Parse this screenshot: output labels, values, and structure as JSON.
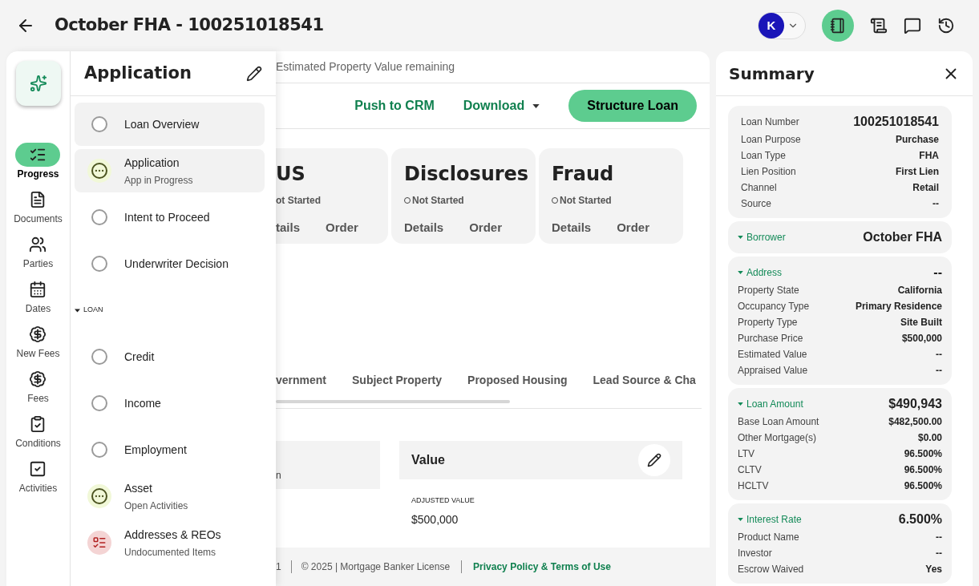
{
  "header": {
    "title": "October FHA - 100251018541",
    "avatar_initial": "K"
  },
  "rail": {
    "items": [
      {
        "label": "Progress",
        "selected": true
      },
      {
        "label": "Documents",
        "selected": false
      },
      {
        "label": "Parties",
        "selected": false
      },
      {
        "label": "Dates",
        "selected": false
      },
      {
        "label": "New Fees",
        "selected": false
      },
      {
        "label": "Fees",
        "selected": false
      },
      {
        "label": "Conditions",
        "selected": false
      },
      {
        "label": "Activities",
        "selected": false
      }
    ]
  },
  "application": {
    "title": "Application",
    "items": [
      {
        "kind": "not_started",
        "label": "Loan Overview",
        "highlighted": true
      },
      {
        "kind": "in_progress",
        "label": "Application",
        "sublabel": "App in Progress",
        "highlighted": true
      },
      {
        "kind": "not_started",
        "label": "Intent to Proceed",
        "highlighted": false
      },
      {
        "kind": "not_started",
        "label": "Underwriter Decision",
        "highlighted": false
      },
      {
        "kind": "section",
        "label": "LOAN",
        "expanded": true
      },
      {
        "kind": "not_started",
        "label": "Credit",
        "highlighted": false
      },
      {
        "kind": "not_started",
        "label": "Income",
        "highlighted": false
      },
      {
        "kind": "not_started",
        "label": "Employment",
        "highlighted": false
      },
      {
        "kind": "in_progress",
        "label": "Asset",
        "sublabel": "Open Activities",
        "highlighted": false
      },
      {
        "kind": "issue",
        "label": "Addresses & REOs",
        "sublabel": "Undocumented Items",
        "highlighted": false
      }
    ]
  },
  "main": {
    "notice": "Estimated Property Value remaining",
    "actions": [
      {
        "kind": "link",
        "label": "Push to CRM"
      },
      {
        "kind": "dropdown",
        "label": "Download"
      },
      {
        "kind": "primary",
        "label": "Structure Loan"
      }
    ],
    "services": [
      {
        "title": "US",
        "status": "ot Started",
        "details": "tails",
        "order": "Order",
        "cut": true
      },
      {
        "title": "Disclosures",
        "status": "Not Started",
        "details": "Details",
        "order": "Order",
        "cut": false
      },
      {
        "title": "Fraud",
        "status": "Not Started",
        "details": "Details",
        "order": "Order",
        "cut": false
      }
    ],
    "tabs": [
      {
        "label": "vernment",
        "selected": false
      },
      {
        "label": "Subject Property",
        "selected": false
      },
      {
        "label": "Proposed Housing",
        "selected": false
      },
      {
        "label": "Lead Source & Cha",
        "selected": false
      }
    ],
    "left_card": {
      "text": "n"
    },
    "value_card": {
      "title": "Value",
      "field_label": "ADJUSTED VALUE",
      "field_value": "$500,000"
    },
    "footer": {
      "version": "1",
      "copyright": "© 2025 | Mortgage Banker License",
      "link": "Privacy Policy & Terms of Use"
    }
  },
  "summary": {
    "title": "Summary",
    "sections": [
      {
        "headline": {
          "label": "Loan Number",
          "value": "100251018541"
        },
        "rows": [
          {
            "label": "Loan Purpose",
            "value": "Purchase"
          },
          {
            "label": "Loan Type",
            "value": "FHA"
          },
          {
            "label": "Lien Position",
            "value": "First Lien"
          },
          {
            "label": "Channel",
            "value": "Retail"
          },
          {
            "label": "Source",
            "value": "--"
          }
        ]
      },
      {
        "title": "Borrower",
        "value": "October FHA",
        "expanded": true
      },
      {
        "title": "Address",
        "value": "--",
        "expanded": true,
        "rows": [
          {
            "label": "Property State",
            "value": "California"
          },
          {
            "label": "Occupancy Type",
            "value": "Primary Residence"
          },
          {
            "label": "Property Type",
            "value": "Site Built"
          },
          {
            "label": "Purchase Price",
            "value": "$500,000"
          },
          {
            "label": "Estimated Value",
            "value": "--"
          },
          {
            "label": "Appraised Value",
            "value": "--"
          }
        ]
      },
      {
        "title": "Loan Amount",
        "value": "$490,943",
        "expanded": true,
        "rows": [
          {
            "label": "Base Loan Amount",
            "value": "$482,500.00"
          },
          {
            "label": "Other Mortgage(s)",
            "value": "$0.00"
          },
          {
            "label": "LTV",
            "value": "96.500%"
          },
          {
            "label": "CLTV",
            "value": "96.500%"
          },
          {
            "label": "HCLTV",
            "value": "96.500%"
          }
        ]
      },
      {
        "title": "Interest Rate",
        "value": "6.500%",
        "expanded": true,
        "rows": [
          {
            "label": "Product Name",
            "value": "--"
          },
          {
            "label": "Investor",
            "value": "--"
          },
          {
            "label": "Escrow Waived",
            "value": "Yes"
          }
        ]
      }
    ]
  }
}
